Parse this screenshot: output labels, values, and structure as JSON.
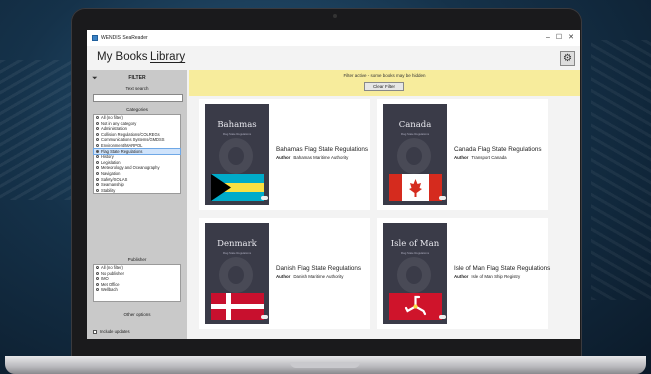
{
  "window": {
    "title": "WENDIS SeaReader",
    "buttons": [
      "–",
      "☐",
      "✕"
    ]
  },
  "nav": {
    "tabs": [
      {
        "label": "My Books",
        "active": false
      },
      {
        "label": "Library",
        "active": true
      }
    ],
    "settings_icon": "gear-icon"
  },
  "sidebar": {
    "filter_title": "FILTER",
    "text_search_label": "Text search",
    "text_search_value": "",
    "categories_label": "Categories",
    "categories": [
      {
        "label": "All (no filter)",
        "selected": false
      },
      {
        "label": "Not in any category",
        "selected": false
      },
      {
        "label": "Administration",
        "selected": false
      },
      {
        "label": "Collision Regulations/COLREGs",
        "selected": false
      },
      {
        "label": "Communications Systems/GMDSS",
        "selected": false
      },
      {
        "label": "Environment/MARPOL",
        "selected": false
      },
      {
        "label": "Flag State Regulations",
        "selected": true
      },
      {
        "label": "History",
        "selected": false
      },
      {
        "label": "Legislation",
        "selected": false
      },
      {
        "label": "Meteorology and Oceanography",
        "selected": false
      },
      {
        "label": "Navigation",
        "selected": false
      },
      {
        "label": "Safety/SOLAS",
        "selected": false
      },
      {
        "label": "Seamanship",
        "selected": false
      },
      {
        "label": "Stability",
        "selected": false
      }
    ],
    "publisher_label": "Publisher",
    "publishers": [
      {
        "label": "All (no filter)",
        "selected": true
      },
      {
        "label": "No publisher",
        "selected": false
      },
      {
        "label": "IMO",
        "selected": false
      },
      {
        "label": "Met Office",
        "selected": false
      },
      {
        "label": "Wellbach",
        "selected": false
      }
    ],
    "other_options_label": "Other options",
    "include_updates_label": "Include updates",
    "include_updates_checked": false
  },
  "banner": {
    "text": "Filter active - some books may be hidden",
    "clear_button": "Clear Filter"
  },
  "books": [
    {
      "cover_title": "Bahamas",
      "cover_subtitle": "Flag State Regulations",
      "flag": "bahamas",
      "title": "Bahamas Flag State Regulations",
      "author_label": "Author",
      "author": "Bahamas Maritime Authority"
    },
    {
      "cover_title": "Canada",
      "cover_subtitle": "Flag State Regulations",
      "flag": "canada",
      "title": "Canada Flag State Regulations",
      "author_label": "Author",
      "author": "Transport Canada"
    },
    {
      "cover_title": "Denmark",
      "cover_subtitle": "Flag State Regulations",
      "flag": "denmark",
      "title": "Danish Flag State Regulations",
      "author_label": "Author",
      "author": "Danish Maritime Authority"
    },
    {
      "cover_title": "Isle of Man",
      "cover_subtitle": "Flag State Regulations",
      "flag": "isle-of-man",
      "title": "Isle of Man Flag State Regulations",
      "author_label": "Author",
      "author": "Isle of Man Ship Registry"
    }
  ],
  "colors": {
    "banner": "#f7ec9c",
    "sidebar": "#c9c9c9",
    "cover": "#3a3b48",
    "selection": "#cfe3fb"
  }
}
